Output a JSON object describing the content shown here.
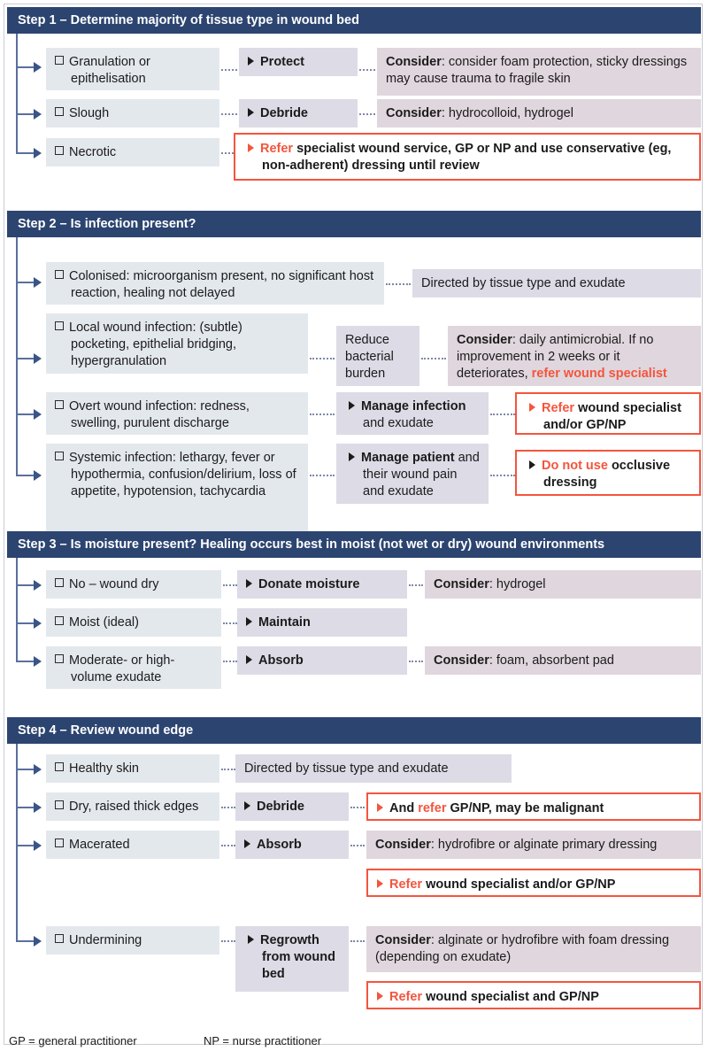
{
  "figure": {
    "accent_navy": "#2c4470",
    "accent_red": "#f4553d",
    "condition_bg": "#e3e8ed",
    "action_bg": "#dcdbe6",
    "consider_bg": "#e0d6dd"
  },
  "steps": [
    {
      "id": "step1",
      "header": "Step 1 – Determine majority of tissue type in wound bed",
      "rows": [
        {
          "condition": "Granulation or epithelisation",
          "action": "Protect",
          "consider_label": "Consider",
          "consider_text": ": consider foam protection, sticky dressings may cause trauma to fragile skin"
        },
        {
          "condition": "Slough",
          "action": "Debride",
          "consider_label": "Consider",
          "consider_text": ": hydrocolloid, hydrogel"
        },
        {
          "condition": "Necrotic",
          "alert_red": "Refer",
          "alert_rest": " specialist wound service, GP or NP and use conservative (eg, non-adherent) dressing until review"
        }
      ]
    },
    {
      "id": "step2",
      "header": "Step 2 – Is infection present?",
      "rows": [
        {
          "condition": "Colonised: microorganism present, no significant host reaction, healing not delayed",
          "plain": "Directed by tissue type and exudate"
        },
        {
          "condition": "Local wound infection: (subtle) pocketing, epithelial bridging, hypergranulation",
          "action": "Reduce bacterial burden",
          "consider_label": "Consider",
          "consider_text": ": daily antimicrobial. If no improvement in 2 weeks or it deteriorates, ",
          "consider_red": "refer wound specialist"
        },
        {
          "condition": "Overt wound infection: redness, swelling, purulent discharge",
          "action_strong": "Manage infection",
          "action_rest": " and exudate",
          "alert_red": "Refer",
          "alert_rest": " wound specialist and/or GP/NP"
        },
        {
          "condition": "Systemic infection: lethargy, fever or hypothermia, confusion/delirium, loss of appetite, hypotension, tachycardia",
          "action_strong": "Manage patient",
          "action_rest": " and their wound pain and exudate",
          "alert_red": "Do not use",
          "alert_rest": " occlusive dressing",
          "alert_bullet_dark": true
        }
      ]
    },
    {
      "id": "step3",
      "header": "Step 3 – Is moisture present? Healing occurs best in moist (not wet or dry) wound environments",
      "rows": [
        {
          "condition": "No – wound dry",
          "action": "Donate moisture",
          "consider_label": "Consider",
          "consider_text": ": hydrogel"
        },
        {
          "condition": "Moist (ideal)",
          "action": "Maintain"
        },
        {
          "condition": "Moderate- or high-volume exudate",
          "action": "Absorb",
          "consider_label": "Consider",
          "consider_text": ": foam, absorbent pad"
        }
      ]
    },
    {
      "id": "step4",
      "header": "Step 4 – Review wound edge",
      "rows": [
        {
          "condition": "Healthy skin",
          "plain": "Directed by tissue type and exudate"
        },
        {
          "condition": "Dry, raised thick edges",
          "action": "Debride",
          "alert_dark": "And ",
          "alert_red": "refer",
          "alert_rest": " GP/NP, may be malignant"
        },
        {
          "condition": "Macerated",
          "action": "Absorb",
          "consider_label": "Consider",
          "consider_text": ": hydrofibre or alginate primary dressing"
        },
        {
          "alert_red": "Refer",
          "alert_rest": " wound specialist and/or GP/NP"
        },
        {
          "condition": "Undermining",
          "action": "Regrowth from wound bed",
          "consider_label": "Consider",
          "consider_text": ": alginate or hydrofibre with foam dressing (depending on exudate)"
        },
        {
          "alert_red": "Refer",
          "alert_rest": " wound specialist and GP/NP"
        }
      ]
    }
  ],
  "footnotes": {
    "gp": "GP = general practitioner",
    "np": "NP = nurse practitioner"
  }
}
